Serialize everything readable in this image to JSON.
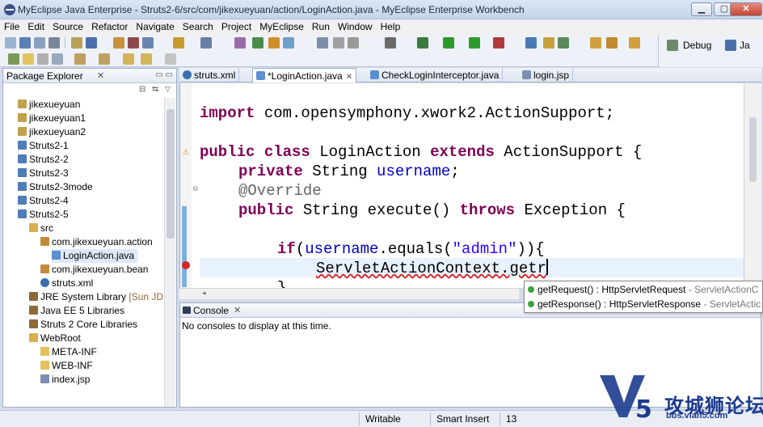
{
  "window": {
    "title": "MyEclipse Java Enterprise - Struts2-6/src/com/jikexueyuan/action/LoginAction.java - MyEclipse Enterprise Workbench"
  },
  "menu": [
    "File",
    "Edit",
    "Source",
    "Refactor",
    "Navigate",
    "Search",
    "Project",
    "MyEclipse",
    "Run",
    "Window",
    "Help"
  ],
  "perspective": {
    "debug_label": "Debug",
    "java_label": "Ja"
  },
  "package_explorer": {
    "title": "Package Explorer",
    "items": [
      "jikexueyuan",
      "jikexueyuan1",
      "jikexueyuan2",
      "Struts2-1",
      "Struts2-2",
      "Struts2-3",
      "Struts2-3mode",
      "Struts2-4",
      "Struts2-5",
      "src",
      "com.jikexueyuan.action",
      "LoginAction.java",
      "com.jikexueyuan.bean",
      "struts.xml",
      "JRE System Library",
      "Java EE 5 Libraries",
      "Struts 2 Core Libraries",
      "WebRoot",
      "META-INF",
      "WEB-INF",
      "index.jsp"
    ],
    "jre_suffix": "[Sun JDK"
  },
  "editor_tabs": [
    "struts.xml",
    "*LoginAction.java",
    "CheckLoginInterceptor.java",
    "login.jsp"
  ],
  "code": {
    "import_kw": "import",
    "import_path": " com.opensymphony.xwork2.ActionSupport;",
    "public_kw": "public",
    "class_kw": "class",
    "class_name": " LoginAction ",
    "extends_kw": "extends",
    "super_name": " ActionSupport {",
    "private_kw": "private",
    "field_type": " String ",
    "field_name": "username",
    "field_end": ";",
    "annotation": "@Override",
    "method_sig": " String execute() ",
    "throws_kw": "throws",
    "exception": " Exception {",
    "if_kw": "if",
    "if_open": "(",
    "if_field": "username",
    "if_call": ".equals(",
    "if_str": "\"admin\"",
    "if_close": ")){",
    "typing": "ServletActionContext.getr",
    "closing": "}"
  },
  "content_assist": [
    {
      "method": "getRequest() : HttpServletRequest",
      "cls": " - ServletActionC"
    },
    {
      "method": "getResponse() : HttpServletResponse",
      "cls": " - ServletActic"
    }
  ],
  "console": {
    "title": "Console",
    "message": "No consoles to display at this time."
  },
  "status": {
    "writable": "Writable",
    "insert_mode": "Smart Insert",
    "position": "13"
  },
  "watermark": {
    "name": "攻城狮论坛",
    "url": "bbs.vlan5.com",
    "logo_text": "V5"
  },
  "colors": {
    "keyword": "#7f0055",
    "field": "#0000c0",
    "string": "#2a00ff",
    "annotation": "#646464"
  }
}
